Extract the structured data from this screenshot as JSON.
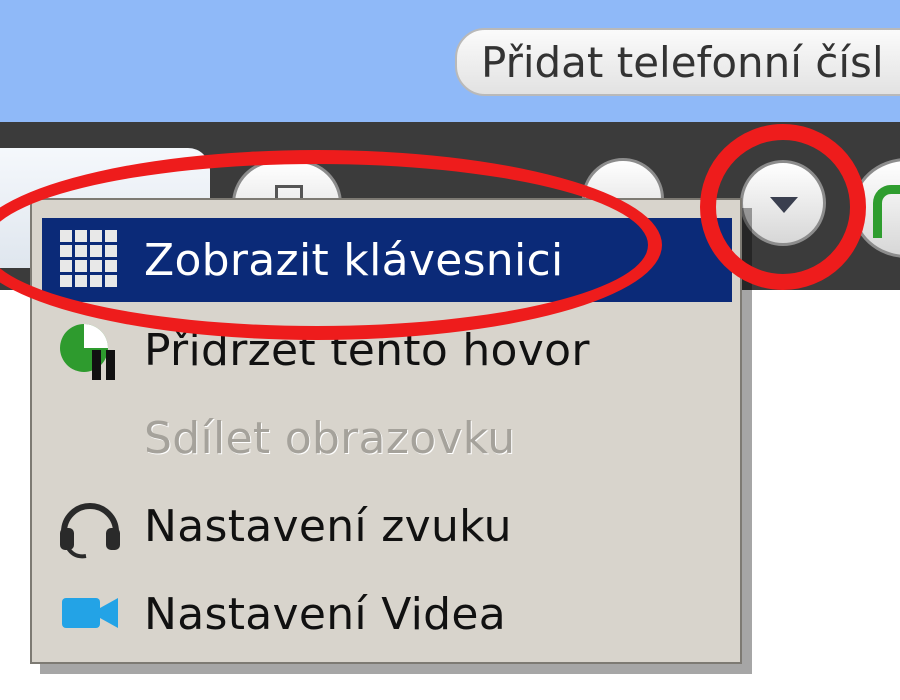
{
  "header": {
    "add_phone_label": "Přidat telefonní čísl"
  },
  "context_menu": {
    "items": [
      {
        "label": "Zobrazit klávesnici",
        "icon": "keypad-icon",
        "highlighted": true,
        "enabled": true
      },
      {
        "label": "Přidržet tento hovor",
        "icon": "hold-call-icon",
        "highlighted": false,
        "enabled": true
      },
      {
        "label": "Sdílet obrazovku",
        "icon": "",
        "highlighted": false,
        "enabled": false
      },
      {
        "label": "Nastavení zvuku",
        "icon": "headset-icon",
        "highlighted": false,
        "enabled": true
      },
      {
        "label": "Nastavení Videa",
        "icon": "video-camera-icon",
        "highlighted": false,
        "enabled": true
      }
    ]
  },
  "toolbar": {
    "icons": [
      "mail-icon",
      "mute-icon",
      "dropdown-arrow-icon",
      "call-icon"
    ]
  },
  "annotations": {
    "color": "#ee1c1c"
  },
  "colors": {
    "header_blue": "#8fb9f8",
    "toolbar_dark": "#3b3b3b",
    "menu_bg": "#d8d4cc",
    "menu_highlight": "#0b2a78",
    "disabled_text": "#a5a29b"
  }
}
